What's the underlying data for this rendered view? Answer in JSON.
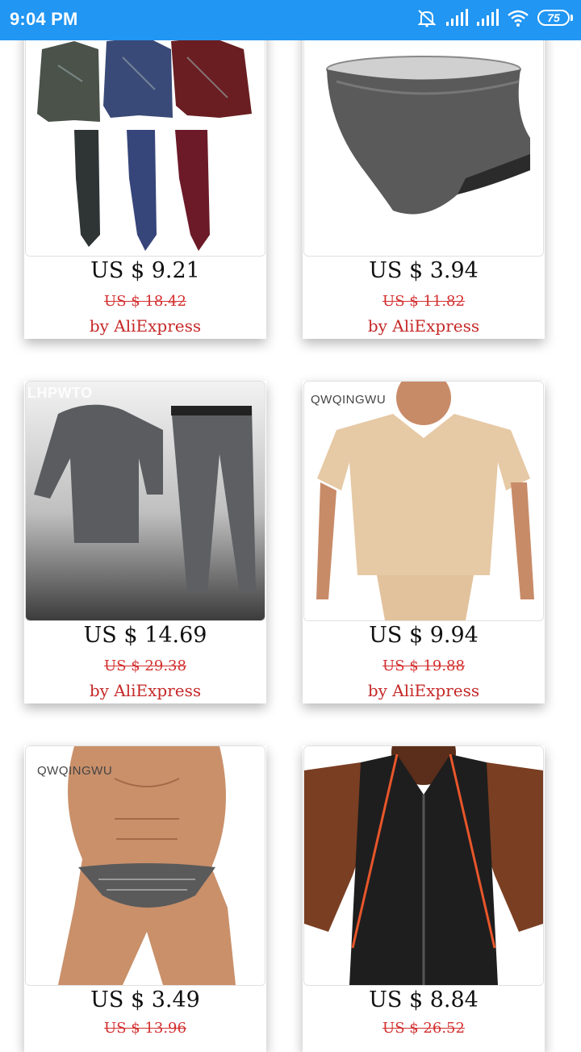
{
  "status_bar": {
    "time": "9:04 PM",
    "battery": "75",
    "icons": [
      "mute-icon",
      "signal-icon",
      "signal-icon",
      "wifi-icon",
      "battery-icon"
    ]
  },
  "products": [
    {
      "image": "compression-suit-set",
      "price": "US $ 9.21",
      "original_price": "US $ 18.42",
      "seller": "by AliExpress",
      "watermark": ""
    },
    {
      "image": "gray-brief",
      "price": "US $ 3.94",
      "original_price": "US $ 11.82",
      "seller": "by AliExpress",
      "watermark": ""
    },
    {
      "image": "gray-compression-set",
      "price": "US $ 14.69",
      "original_price": "US $ 29.38",
      "seller": "by AliExpress",
      "watermark": "LHPWTO"
    },
    {
      "image": "nude-vneck-shirt",
      "price": "US $ 9.94",
      "original_price": "US $ 19.88",
      "seller": "by AliExpress",
      "watermark": "QWQINGWU"
    },
    {
      "image": "camo-thong",
      "price": "US $ 3.49",
      "original_price": "US $ 13.96",
      "seller": "",
      "watermark": "QWQINGWU"
    },
    {
      "image": "sweat-vest",
      "price": "US $ 8.84",
      "original_price": "US $ 26.52",
      "seller": "",
      "watermark": ""
    }
  ],
  "colors": {
    "status_bar": "#2196f3",
    "seller": "#c62828",
    "original_price": "#d32f2f"
  }
}
